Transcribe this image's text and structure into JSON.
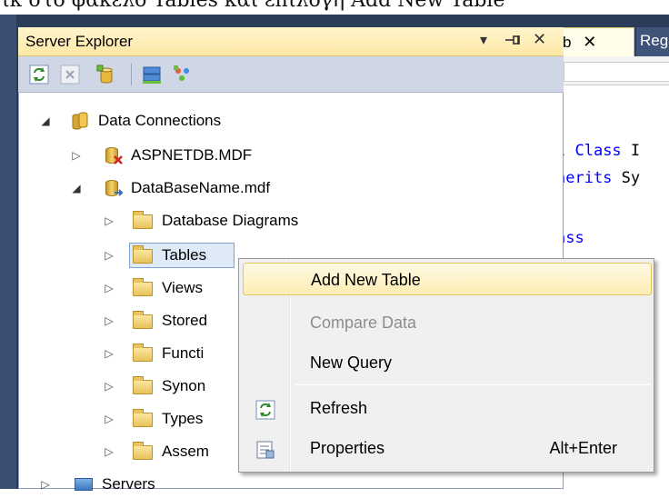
{
  "caption": "ικ στο φάκελο Tables και επιλογή Add New Table",
  "editor": {
    "tab_doc_label": "b",
    "tab_close": "✕",
    "tab_reg_label": "Reg",
    "code_lines": [
      {
        "prefix": "l ",
        "kw": "Class",
        "rest": " I"
      },
      {
        "prefix": "herits ",
        "kw": "",
        "rest": "Sy"
      },
      {
        "prefix": "ass",
        "kw": "",
        "rest": ""
      }
    ]
  },
  "server_explorer": {
    "title": "Server Explorer",
    "controls": {
      "dropdown": "▾",
      "pin": "⊣",
      "close": "✕"
    },
    "toolbar": {
      "icons": [
        "refresh-icon",
        "stop-icon",
        "connect-to-database-icon",
        "connect-to-server-icon",
        "sharepoint-icon"
      ]
    },
    "tree": [
      {
        "label": "Data Connections",
        "level": 0,
        "expanded": true,
        "icon": "data-connections-icon"
      },
      {
        "label": "ASPNETDB.MDF",
        "level": 1,
        "expanded": false,
        "icon": "database-disconnected-icon"
      },
      {
        "label": "DataBaseName.mdf",
        "level": 1,
        "expanded": true,
        "icon": "database-icon"
      },
      {
        "label": "Database Diagrams",
        "level": 2,
        "expanded": false,
        "icon": "folder-icon"
      },
      {
        "label": "Tables",
        "level": 2,
        "expanded": false,
        "icon": "folder-icon",
        "selected": true
      },
      {
        "label": "Views",
        "level": 2,
        "expanded": false,
        "icon": "folder-icon"
      },
      {
        "label": "Stored",
        "level": 2,
        "expanded": false,
        "icon": "folder-icon"
      },
      {
        "label": "Functi",
        "level": 2,
        "expanded": false,
        "icon": "folder-icon"
      },
      {
        "label": "Synon",
        "level": 2,
        "expanded": false,
        "icon": "folder-icon"
      },
      {
        "label": "Types",
        "level": 2,
        "expanded": false,
        "icon": "folder-icon"
      },
      {
        "label": "Assem",
        "level": 2,
        "expanded": false,
        "icon": "folder-icon"
      },
      {
        "label": "Servers",
        "level": 0,
        "expanded": false,
        "icon": "servers-icon"
      }
    ]
  },
  "context_menu": {
    "items": [
      {
        "label": "Add New Table",
        "highlighted": true
      },
      {
        "label": "Compare Data",
        "disabled": true
      },
      {
        "label": "New Query"
      },
      {
        "label": "Refresh",
        "icon": "refresh-icon"
      },
      {
        "label": "Properties",
        "icon": "properties-icon",
        "shortcut": "Alt+Enter"
      }
    ]
  },
  "colors": {
    "ide_background": "#2b3c59",
    "title_gradient_top": "#fff4cc",
    "highlight_border": "#e5c365",
    "keyword_blue": "#0000ff"
  }
}
